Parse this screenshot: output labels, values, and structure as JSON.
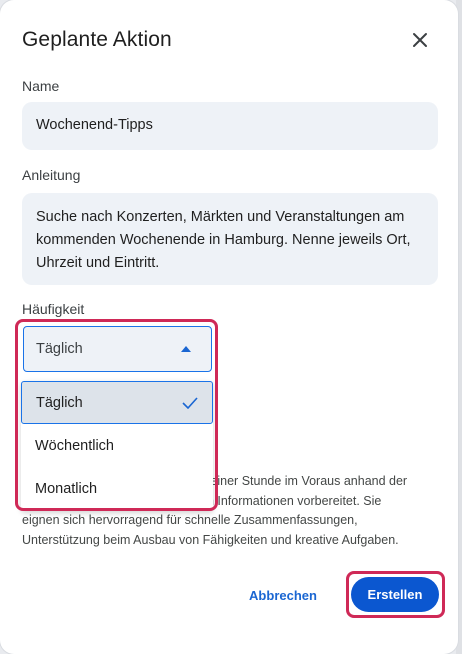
{
  "dialog": {
    "title": "Geplante Aktion",
    "close_icon": "close-icon"
  },
  "name": {
    "label": "Name",
    "value": "Wochenend-Tipps"
  },
  "instructions": {
    "label": "Anleitung",
    "value": "Suche nach Konzerten, Märkten und Veranstaltungen am kommenden Wochenende in Hamburg. Nenne jeweils Ort, Uhrzeit und Eintritt."
  },
  "frequency": {
    "label": "Häufigkeit",
    "selected": "Täglich",
    "arrow_icon": "caret-up-icon",
    "options": [
      {
        "label": "Täglich",
        "selected": true,
        "check_icon": "check-icon"
      },
      {
        "label": "Wöchentlich",
        "selected": false
      },
      {
        "label": "Monatlich",
        "selected": false
      }
    ]
  },
  "description": {
    "lines": [
      "u einer Stunde im Voraus anhand der",
      "en Informationen vorbereitet. Sie",
      "eignen sich hervorragend für schnelle Zusammenfassungen,",
      "Unterstützung beim Ausbau von Fähigkeiten und kreative Aufgaben."
    ]
  },
  "actions": {
    "cancel_label": "Abbrechen",
    "create_label": "Erstellen"
  },
  "colors": {
    "accent": "#0b57d0",
    "highlight": "#cf2957",
    "field_bg": "#eef2f7"
  }
}
